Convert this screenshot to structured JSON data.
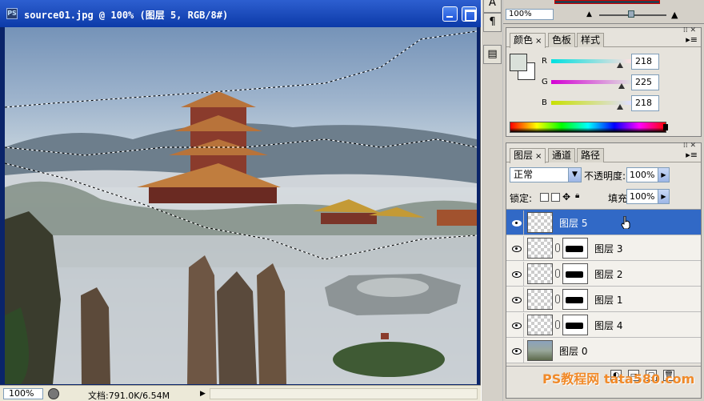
{
  "document": {
    "title": "source01.jpg @ 100% (图层 5, RGB/8#)",
    "ps_badge": "PS"
  },
  "status": {
    "zoom": "100%",
    "doc_info": "文档:791.0K/6.54M"
  },
  "navigator": {
    "zoom": "100%"
  },
  "color_panel": {
    "tabs": [
      {
        "label": "颜色",
        "close": "×"
      },
      {
        "label": "色板"
      },
      {
        "label": "样式"
      }
    ],
    "channels": [
      {
        "label": "R",
        "value": "218",
        "level": 0.855,
        "gradient": "linear-gradient(90deg,#00e0e0,#ffe0e0)"
      },
      {
        "label": "G",
        "value": "225",
        "level": 0.882,
        "gradient": "linear-gradient(90deg,#d400d4,#e0e0e0)"
      },
      {
        "label": "B",
        "value": "218",
        "level": 0.855,
        "gradient": "linear-gradient(90deg,#c8e000,#e0e0ff)"
      }
    ],
    "foreground": "#dae1da",
    "background": "#ffffff"
  },
  "layers_panel": {
    "tabs": [
      {
        "label": "图层",
        "close": "×"
      },
      {
        "label": "通道"
      },
      {
        "label": "路径"
      }
    ],
    "blend_mode": "正常",
    "opacity_label": "不透明度:",
    "opacity": "100%",
    "lock_label": "锁定:",
    "fill_label": "填充:",
    "fill": "100%",
    "layers": [
      {
        "name": "图层 5",
        "selected": true,
        "mask": false,
        "thumb": "transparent"
      },
      {
        "name": "图层 3",
        "selected": false,
        "mask": true,
        "thumb": "transparent"
      },
      {
        "name": "图层 2",
        "selected": false,
        "mask": true,
        "thumb": "transparent"
      },
      {
        "name": "图层 1",
        "selected": false,
        "mask": true,
        "thumb": "transparent"
      },
      {
        "name": "图层 4",
        "selected": false,
        "mask": true,
        "thumb": "transparent"
      },
      {
        "name": "图层 0",
        "selected": false,
        "mask": false,
        "thumb": "image"
      }
    ]
  },
  "watermark": "PS教程网 tata580.com",
  "icons": [
    "ps-icon",
    "minimize-icon",
    "maximize-icon",
    "brush-tool-icon",
    "paragraph-icon",
    "notes-icon",
    "eye-icon",
    "chain-link-icon",
    "lock-icon",
    "move-icon",
    "hand-cursor-icon"
  ]
}
